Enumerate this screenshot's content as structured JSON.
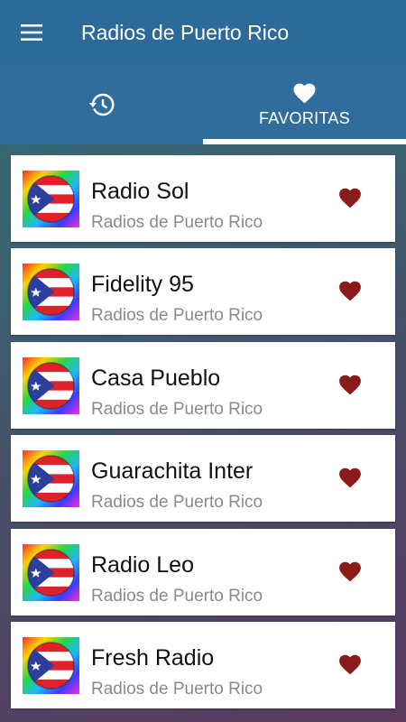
{
  "app": {
    "title": "Radios de Puerto Rico",
    "menu_icon": "hamburger-menu-icon"
  },
  "tabs": [
    {
      "icon": "history-icon",
      "label": ""
    },
    {
      "icon": "heart-icon",
      "label": "FAVORITAS",
      "selected": true
    }
  ],
  "stations": [
    {
      "name": "Radio Sol",
      "subtitle": "Radios de Puerto Rico"
    },
    {
      "name": "Fidelity 95",
      "subtitle": "Radios de Puerto Rico"
    },
    {
      "name": "Casa Pueblo",
      "subtitle": "Radios de Puerto Rico"
    },
    {
      "name": "Guarachita Inter",
      "subtitle": "Radios de Puerto Rico"
    },
    {
      "name": "Radio Leo",
      "subtitle": "Radios de Puerto Rico"
    },
    {
      "name": "Fresh Radio",
      "subtitle": "Radios de Puerto Rico"
    }
  ],
  "colors": {
    "appbar": "#2b6a99",
    "tabbar": "#316d9c",
    "heart": "#8b1a1a"
  }
}
